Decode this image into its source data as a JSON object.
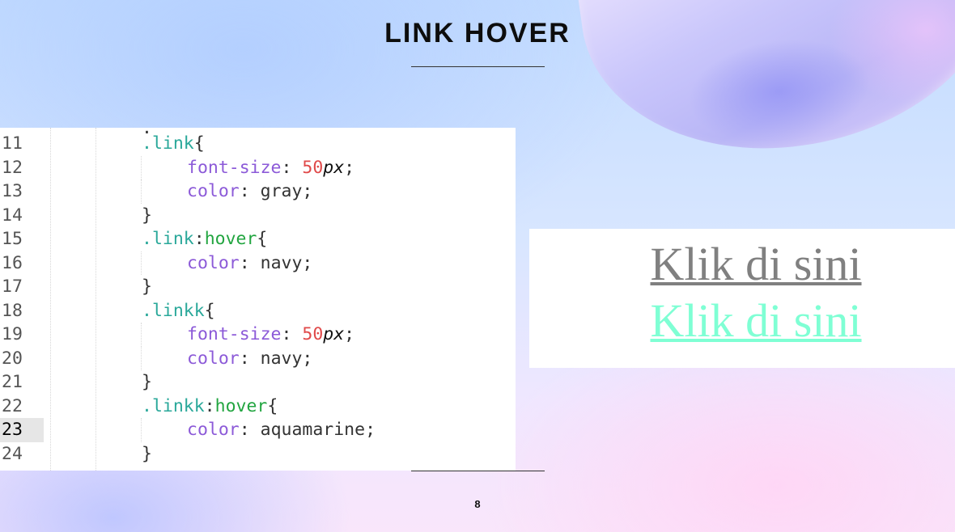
{
  "slide": {
    "title": "LINK HOVER",
    "page_number": "8"
  },
  "editor": {
    "lines": [
      {
        "num": "11",
        "parts": [
          {
            "t": ".link",
            "c": "sel"
          },
          {
            "t": "{",
            "c": ""
          }
        ]
      },
      {
        "num": "12",
        "parts": [
          {
            "t": "font-size",
            "c": "prop"
          },
          {
            "t": ": ",
            "c": ""
          },
          {
            "t": "50",
            "c": "num"
          },
          {
            "t": "px",
            "c": "unit"
          },
          {
            "t": ";",
            "c": ""
          }
        ]
      },
      {
        "num": "13",
        "parts": [
          {
            "t": "color",
            "c": "prop"
          },
          {
            "t": ": gray;",
            "c": ""
          }
        ]
      },
      {
        "num": "14",
        "parts": [
          {
            "t": "}",
            "c": ""
          }
        ]
      },
      {
        "num": "15",
        "parts": [
          {
            "t": ".link",
            "c": "sel"
          },
          {
            "t": ":",
            "c": ""
          },
          {
            "t": "hover",
            "c": "pseudo"
          },
          {
            "t": "{",
            "c": ""
          }
        ]
      },
      {
        "num": "16",
        "parts": [
          {
            "t": "color",
            "c": "prop"
          },
          {
            "t": ": navy;",
            "c": ""
          }
        ]
      },
      {
        "num": "17",
        "parts": [
          {
            "t": "}",
            "c": ""
          }
        ]
      },
      {
        "num": "18",
        "parts": [
          {
            "t": ".linkk",
            "c": "sel"
          },
          {
            "t": "{",
            "c": ""
          }
        ]
      },
      {
        "num": "19",
        "parts": [
          {
            "t": "font-size",
            "c": "prop"
          },
          {
            "t": ": ",
            "c": ""
          },
          {
            "t": "50",
            "c": "num"
          },
          {
            "t": "px",
            "c": "unit"
          },
          {
            "t": ";",
            "c": ""
          }
        ]
      },
      {
        "num": "20",
        "parts": [
          {
            "t": "color",
            "c": "prop"
          },
          {
            "t": ": navy;",
            "c": ""
          }
        ]
      },
      {
        "num": "21",
        "parts": [
          {
            "t": "}",
            "c": ""
          }
        ]
      },
      {
        "num": "22",
        "parts": [
          {
            "t": ".linkk",
            "c": "sel"
          },
          {
            "t": ":",
            "c": ""
          },
          {
            "t": "hover",
            "c": "pseudo"
          },
          {
            "t": "{",
            "c": ""
          }
        ]
      },
      {
        "num": "23",
        "parts": [
          {
            "t": "color",
            "c": "prop"
          },
          {
            "t": ": aquamarine;",
            "c": ""
          }
        ]
      },
      {
        "num": "24",
        "parts": [
          {
            "t": "}",
            "c": ""
          }
        ]
      }
    ],
    "current_line": "23"
  },
  "preview": {
    "link1_text": "Klik di sini",
    "link1_color": "#808080",
    "link2_text": "Klik di sini",
    "link2_color": "#7fffd4"
  }
}
